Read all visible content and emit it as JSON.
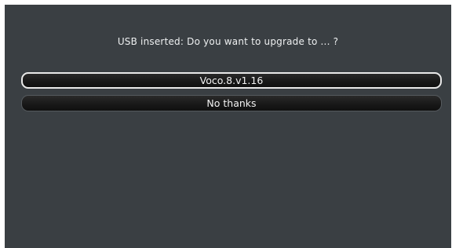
{
  "dialog": {
    "prompt": "USB inserted: Do you want to upgrade to ... ?",
    "options": [
      {
        "label": "Voco.8.v1.16",
        "selected": true
      },
      {
        "label": "No thanks",
        "selected": false
      }
    ]
  },
  "colors": {
    "background": "#3a3f43",
    "button_fill": "#1a1a1a",
    "selected_border": "#e9e9e9",
    "text": "#eef0f1"
  }
}
